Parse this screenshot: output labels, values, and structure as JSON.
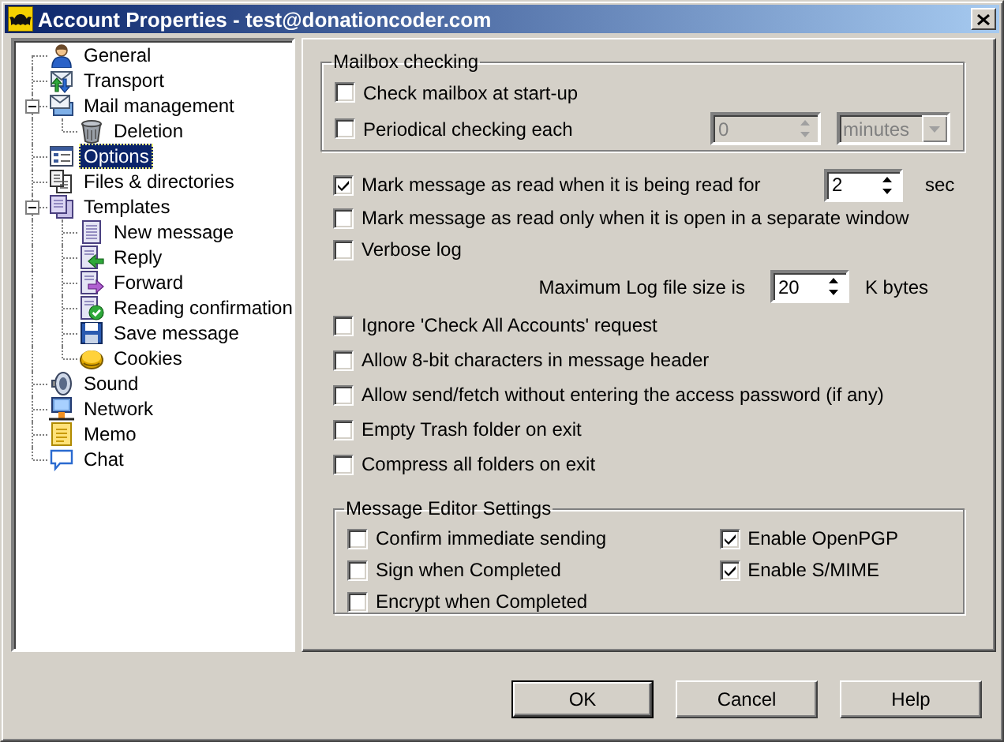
{
  "window": {
    "title": "Account Properties - test@donationcoder.com"
  },
  "tree": [
    {
      "label": "General",
      "selected": false
    },
    {
      "label": "Transport",
      "selected": false
    },
    {
      "label": "Mail management",
      "selected": false,
      "expanded": true,
      "children": [
        {
          "label": "Deletion",
          "selected": false
        }
      ]
    },
    {
      "label": "Options",
      "selected": true
    },
    {
      "label": "Files & directories",
      "selected": false
    },
    {
      "label": "Templates",
      "selected": false,
      "expanded": true,
      "children": [
        {
          "label": "New message",
          "selected": false
        },
        {
          "label": "Reply",
          "selected": false
        },
        {
          "label": "Forward",
          "selected": false
        },
        {
          "label": "Reading confirmation",
          "selected": false
        },
        {
          "label": "Save message",
          "selected": false
        },
        {
          "label": "Cookies",
          "selected": false
        }
      ]
    },
    {
      "label": "Sound",
      "selected": false
    },
    {
      "label": "Network",
      "selected": false
    },
    {
      "label": "Memo",
      "selected": false
    },
    {
      "label": "Chat",
      "selected": false
    }
  ],
  "mailbox_checking": {
    "title": "Mailbox checking",
    "options": [
      {
        "label": "Check mailbox at start-up",
        "checked": false
      },
      {
        "label": "Periodical checking each",
        "checked": false
      }
    ],
    "interval": {
      "value": "0",
      "disabled": true
    },
    "unit": {
      "value": "minutes",
      "disabled": true
    }
  },
  "read_options": [
    {
      "kind": "checkbox_spin",
      "label": "Mark message as read when it is being read for",
      "checked": true,
      "spin": {
        "value": "2",
        "disabled": false
      },
      "unit": "sec"
    },
    {
      "kind": "checkbox",
      "label": "Mark message as read only when it is open in a separate window",
      "checked": false
    },
    {
      "kind": "checkbox",
      "label": "Verbose log",
      "checked": false
    },
    {
      "kind": "spin",
      "label": "Maximum Log file size is",
      "spin": {
        "value": "20",
        "disabled": false
      },
      "unit": "K bytes"
    }
  ],
  "other_options": [
    {
      "label": "Ignore 'Check All Accounts' request",
      "checked": false
    },
    {
      "label": "Allow 8-bit characters in message header",
      "checked": false
    },
    {
      "label": "Allow send/fetch without entering the access password (if any)",
      "checked": false
    },
    {
      "label": "Empty Trash folder on exit",
      "checked": false
    },
    {
      "label": "Compress all folders on exit",
      "checked": false
    }
  ],
  "message_editor": {
    "title": "Message Editor Settings",
    "left": [
      {
        "label": "Confirm immediate sending",
        "checked": false
      },
      {
        "label": "Sign when Completed",
        "checked": false
      },
      {
        "label": "Encrypt when Completed",
        "checked": false
      }
    ],
    "right": [
      {
        "label": "Enable OpenPGP",
        "checked": true
      },
      {
        "label": "Enable S/MIME",
        "checked": true
      }
    ]
  },
  "buttons": [
    {
      "label": "OK",
      "default": true
    },
    {
      "label": "Cancel",
      "default": false
    },
    {
      "label": "Help",
      "default": false
    }
  ]
}
